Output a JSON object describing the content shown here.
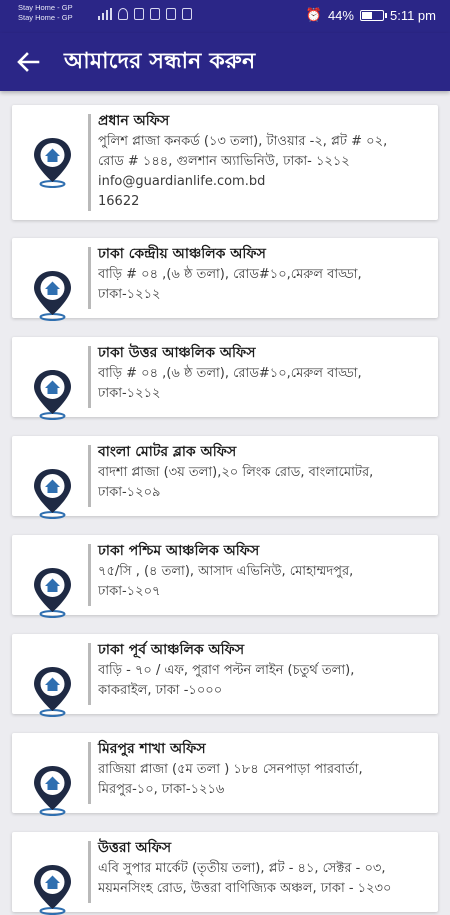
{
  "status_bar": {
    "notifications": [
      "Stay Home - GP",
      "Stay Home - GP"
    ],
    "battery": "44%",
    "battery_level": 0.44,
    "time": "5:11 pm"
  },
  "app_bar": {
    "title": "আমাদের সন্ধান করুন"
  },
  "offices": [
    {
      "name": "প্রধান অফিস",
      "lines": [
        "পুলিশ প্লাজা কনকর্ড (১৩ তলা), টাওয়ার -২, প্লট # ০২,",
        "রোড # ১৪৪, গুলশান অ্যাভিনিউ, ঢাকা- ১২১২",
        "info@guardianlife.com.bd",
        "16622"
      ]
    },
    {
      "name": "ঢাকা কেন্দ্রীয় আঞ্চলিক অফিস",
      "lines": [
        "বাড়ি # ০৪ ,(৬ ষ্ঠ তলা), রোড#১০,মেরুল বাড্ডা,",
        "ঢাকা-১২১২"
      ]
    },
    {
      "name": "ঢাকা উত্তর আঞ্চলিক অফিস",
      "lines": [
        "বাড়ি # ০৪ ,(৬ ষ্ঠ তলা), রোড#১০,মেরুল বাড্ডা,",
        "ঢাকা-১২১২"
      ]
    },
    {
      "name": "বাংলা মোটর ব্লাক অফিস",
      "lines": [
        "বাদশা প্লাজা (৩য় তলা),২০ লিংক রোড, বাংলামোটর,",
        "ঢাকা-১২০৯"
      ]
    },
    {
      "name": "ঢাকা পশ্চিম আঞ্চলিক অফিস",
      "lines": [
        "৭৫/সি , (৪ তলা), আসাদ এভিনিউ, মোহাম্মদপুর,",
        "ঢাকা-১২০৭"
      ]
    },
    {
      "name": "ঢাকা পূর্ব আঞ্চলিক অফিস",
      "lines": [
        "বাড়ি - ৭০ / এফ, পুরাণ পল্টন লাইন (চতুর্থ তলা),",
        "কাকরাইল, ঢাকা -১০০০"
      ]
    },
    {
      "name": "মিরপুর শাখা অফিস",
      "lines": [
        "রাজিয়া প্লাজা (৫ম তলা ) ১৮৪ সেনপাড়া পারবার্তা,",
        "মিরপুর-১০, ঢাকা-১২১৬"
      ]
    },
    {
      "name": "উত্তরা অফিস",
      "lines": [
        "এবি সুপার মার্কেট (তৃতীয় তলা), প্লট - ৪১, সেক্টর - ০৩,",
        "ময়মনসিংহ রোড, উত্তরা বাণিজ্যিক অঞ্চল, ঢাকা - ১২৩০"
      ]
    }
  ],
  "icons": {
    "back": "arrow-left-icon",
    "location": "location-pin-home-icon"
  },
  "colors": {
    "brand": "#2b2687",
    "pin": "#1f2a44",
    "pin_fill": "#2f6fb0",
    "background": "#ececf0"
  }
}
